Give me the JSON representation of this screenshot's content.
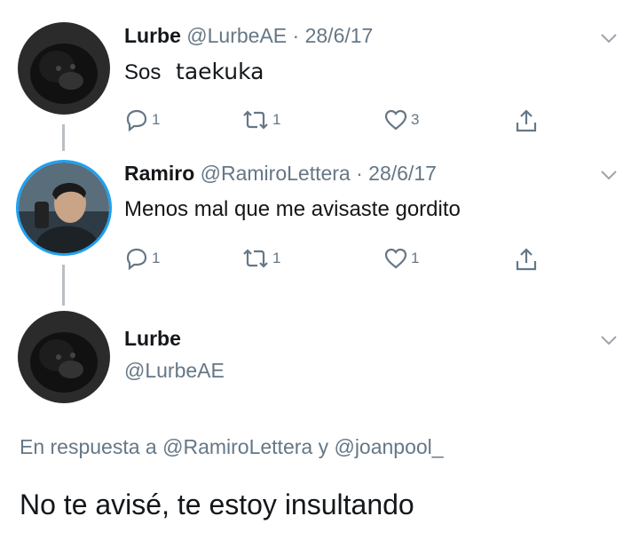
{
  "tweets": [
    {
      "name": "Lurbe",
      "handle": "@LurbeAE",
      "date": "28/6/17",
      "text_prefix": "Sos",
      "text_overlay": "taekuka",
      "replies": "1",
      "retweets": "1",
      "likes": "3"
    },
    {
      "name": "Ramiro",
      "handle": "@RamiroLettera",
      "date": "28/6/17",
      "text": "Menos mal que me avisaste gordito",
      "replies": "1",
      "retweets": "1",
      "likes": "1"
    }
  ],
  "main_tweet": {
    "name": "Lurbe",
    "handle": "@LurbeAE",
    "reply_prefix": "En respuesta a",
    "reply_user1": "@RamiroLettera",
    "reply_joiner": "y",
    "reply_user2": "@joanpool_",
    "text": "No te avisé, te estoy insultando"
  },
  "meta": {
    "separator": "·"
  },
  "colors": {
    "text": "#14171a",
    "secondary": "#657786",
    "thread_line": "#b8bec4",
    "background": "#ffffff"
  },
  "icons": [
    "reply-icon",
    "retweet-icon",
    "like-icon",
    "share-icon",
    "chevron-down-icon"
  ]
}
